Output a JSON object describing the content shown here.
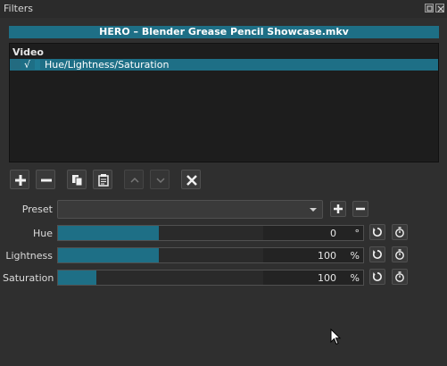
{
  "window": {
    "title": "Filters"
  },
  "clip": {
    "name": "HERO – Blender Grease Pencil Showcase.mkv"
  },
  "filter_list": {
    "category": "Video",
    "items": [
      {
        "checked": "√",
        "name": "Hue/Lightness/Saturation"
      }
    ]
  },
  "toolbar": {
    "buttons": [
      "add-icon",
      "remove-icon",
      "copy-icon",
      "paste-icon",
      "move-up-icon",
      "move-down-icon",
      "deselect-icon"
    ]
  },
  "preset": {
    "label": "Preset",
    "value": ""
  },
  "params": {
    "hue": {
      "label": "Hue",
      "value": "0",
      "unit": "°",
      "level": 0.33
    },
    "lightness": {
      "label": "Lightness",
      "value": "100",
      "unit": "%",
      "level": 0.33
    },
    "saturation": {
      "label": "Saturation",
      "value": "100",
      "unit": "%",
      "level": 0.125
    }
  },
  "colors": {
    "accent": "#1e6f86",
    "background": "#2f2f2f",
    "list_bg": "#1d1d1d"
  }
}
